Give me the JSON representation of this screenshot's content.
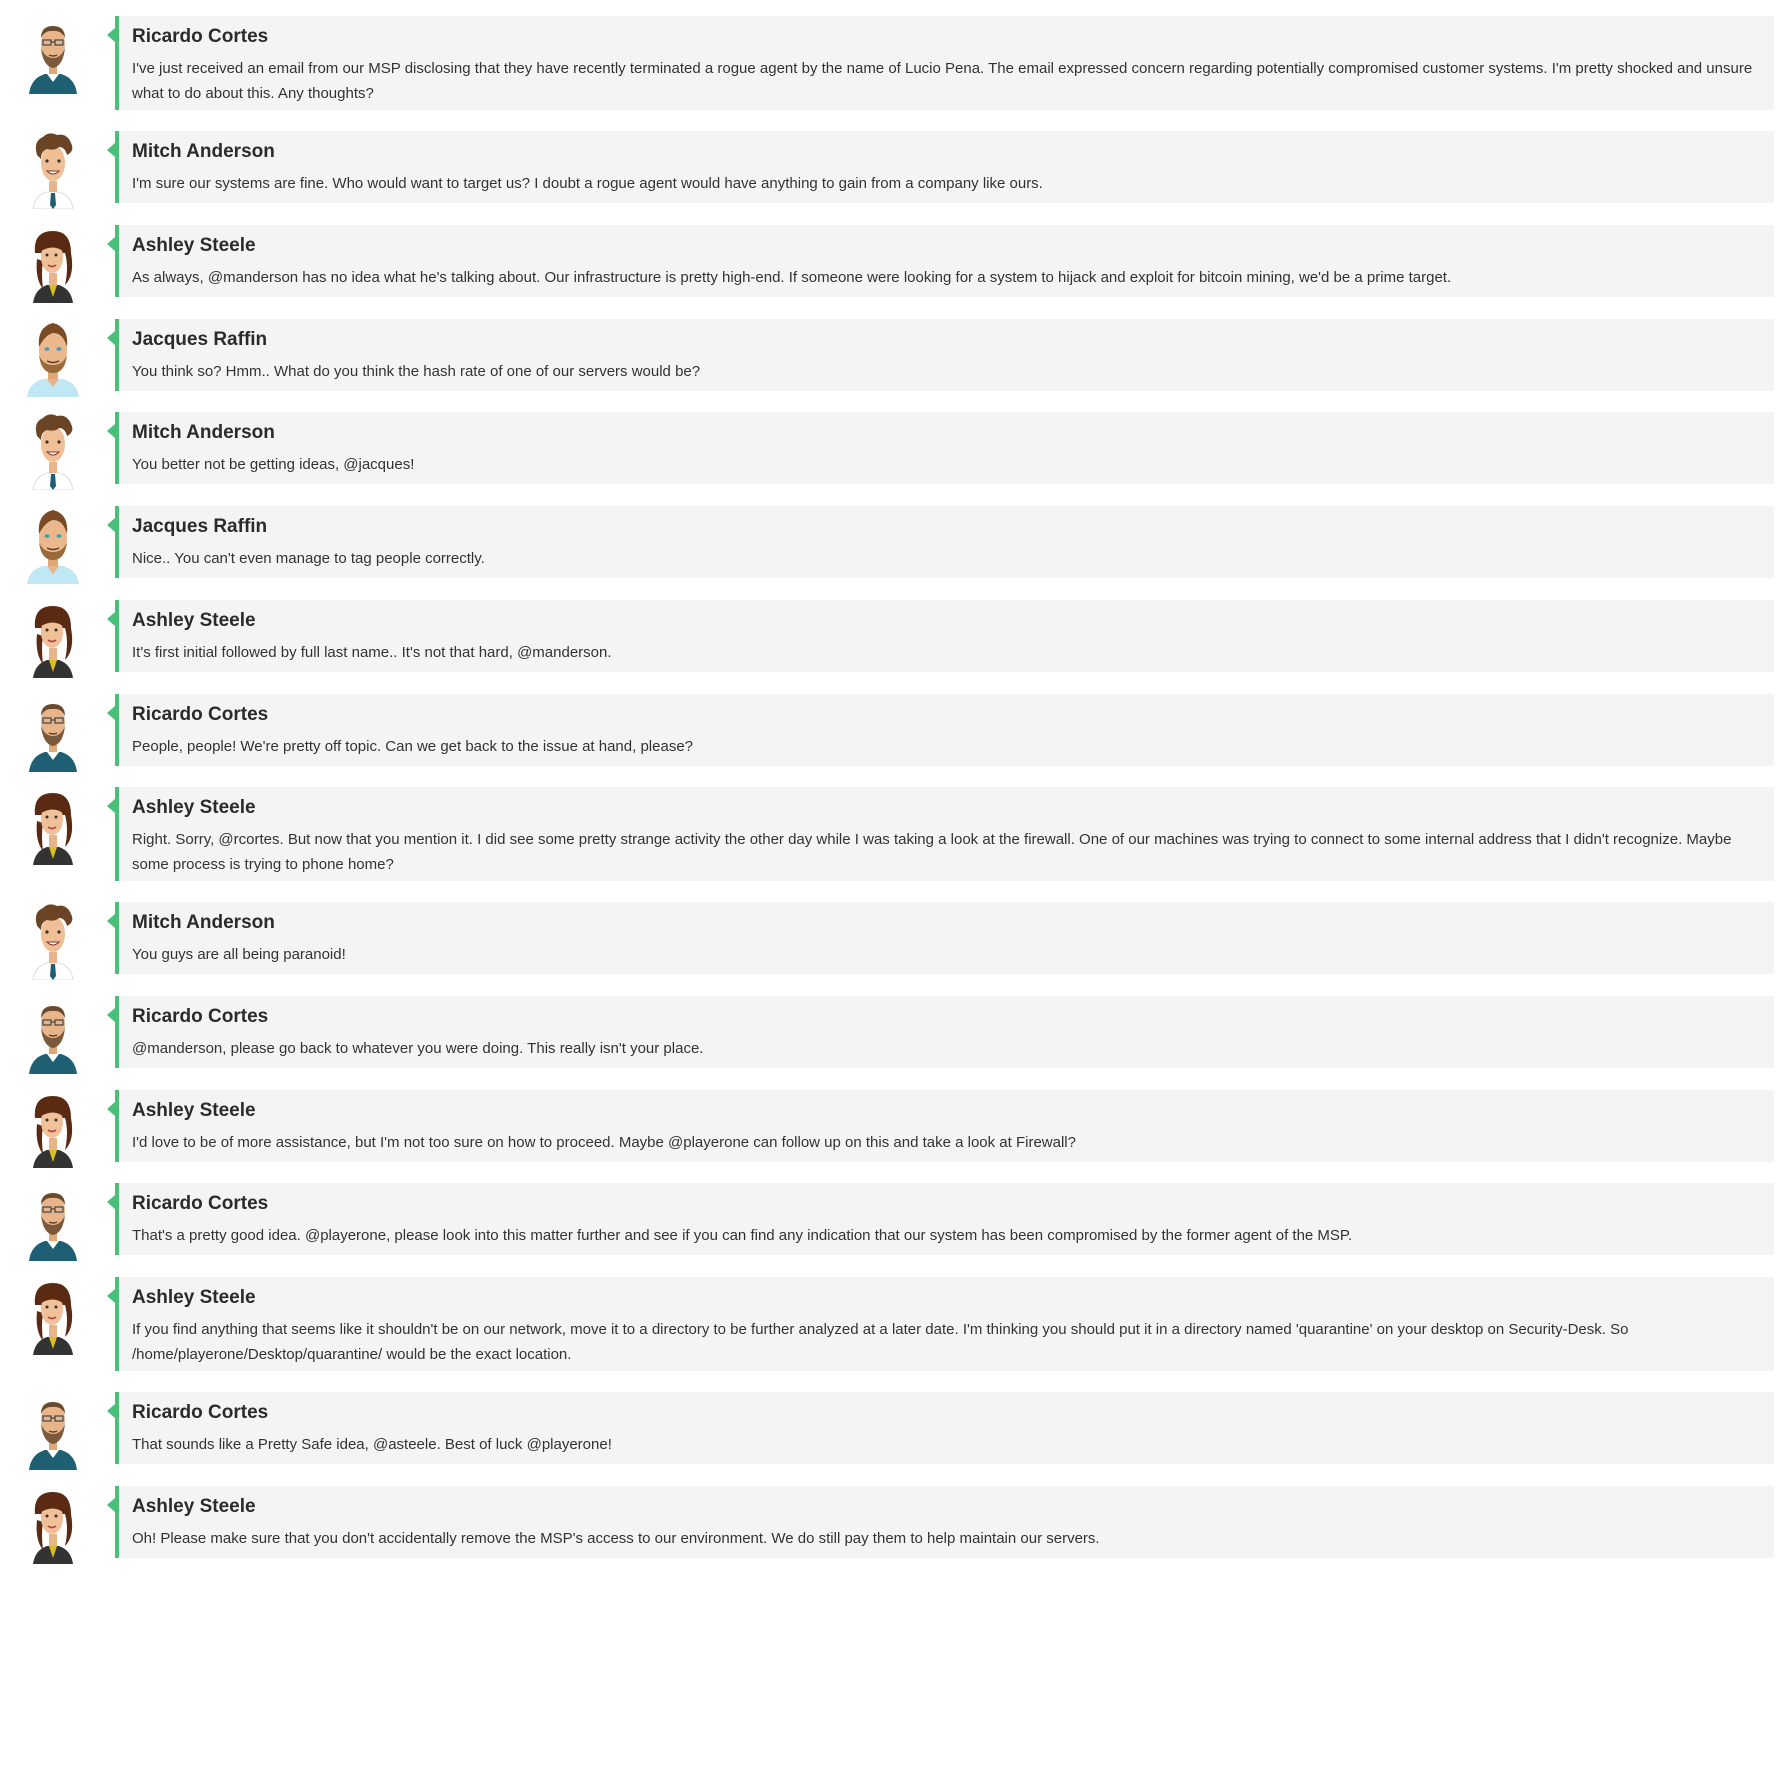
{
  "colors": {
    "accent": "#49c07a",
    "bubble_bg": "#f4f4f4",
    "author_text": "#2b2b2b",
    "body_text": "#333333"
  },
  "messages": [
    {
      "author": "Ricardo Cortes",
      "avatar": "ricardo-avatar",
      "text": "I've just received an email from our MSP disclosing that they have recently terminated a rogue agent by the name of Lucio Pena. The email expressed concern regarding potentially compromised customer systems. I'm pretty shocked and unsure what to do about this. Any thoughts?"
    },
    {
      "author": "Mitch Anderson",
      "avatar": "mitch-avatar",
      "text": "I'm sure our systems are fine. Who would want to target us? I doubt a rogue agent would have anything to gain from a company like ours."
    },
    {
      "author": "Ashley Steele",
      "avatar": "ashley-avatar",
      "text": "As always, @manderson has no idea what he's talking about. Our infrastructure is pretty high-end. If someone were looking for a system to hijack and exploit for bitcoin mining, we'd be a prime target."
    },
    {
      "author": "Jacques Raffin",
      "avatar": "jacques-avatar",
      "text": "You think so? Hmm.. What do you think the hash rate of one of our servers would be?"
    },
    {
      "author": "Mitch Anderson",
      "avatar": "mitch-avatar",
      "text": "You better not be getting ideas, @jacques!"
    },
    {
      "author": "Jacques Raffin",
      "avatar": "jacques-avatar",
      "text": "Nice.. You can't even manage to tag people correctly."
    },
    {
      "author": "Ashley Steele",
      "avatar": "ashley-avatar",
      "text": "It's first initial followed by full last name.. It's not that hard, @manderson."
    },
    {
      "author": "Ricardo Cortes",
      "avatar": "ricardo-avatar",
      "text": "People, people! We're pretty off topic. Can we get back to the issue at hand, please?"
    },
    {
      "author": "Ashley Steele",
      "avatar": "ashley-avatar",
      "text": "Right. Sorry, @rcortes. But now that you mention it. I did see some pretty strange activity the other day while I was taking a look at the firewall. One of our machines was trying to connect to some internal address that I didn't recognize. Maybe some process is trying to phone home?"
    },
    {
      "author": "Mitch Anderson",
      "avatar": "mitch-avatar",
      "text": "You guys are all being paranoid!"
    },
    {
      "author": "Ricardo Cortes",
      "avatar": "ricardo-avatar",
      "text": "@manderson, please go back to whatever you were doing. This really isn't your place."
    },
    {
      "author": "Ashley Steele",
      "avatar": "ashley-avatar",
      "text": "I'd love to be of more assistance, but I'm not too sure on how to proceed. Maybe @playerone can follow up on this and take a look at Firewall?"
    },
    {
      "author": "Ricardo Cortes",
      "avatar": "ricardo-avatar",
      "text": "That's a pretty good idea. @playerone, please look into this matter further and see if you can find any indication that our system has been compromised by the former agent of the MSP."
    },
    {
      "author": "Ashley Steele",
      "avatar": "ashley-avatar",
      "text": "If you find anything that seems like it shouldn't be on our network, move it to a directory to be further analyzed at a later date. I'm thinking you should put it in a directory named 'quarantine' on your desktop on Security-Desk. So /home/playerone/Desktop/quarantine/ would be the exact location."
    },
    {
      "author": "Ricardo Cortes",
      "avatar": "ricardo-avatar",
      "text": "That sounds like a Pretty Safe idea, @asteele. Best of luck @playerone!"
    },
    {
      "author": "Ashley Steele",
      "avatar": "ashley-avatar",
      "text": "Oh! Please make sure that you don't accidentally remove the MSP's access to our environment. We do still pay them to help maintain our servers."
    }
  ]
}
